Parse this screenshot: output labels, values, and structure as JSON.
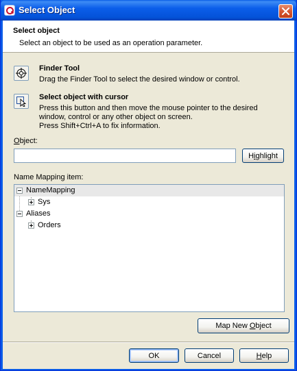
{
  "window": {
    "title": "Select Object"
  },
  "header": {
    "title": "Select object",
    "subtitle": "Select an object to be used as an operation parameter."
  },
  "finder_tool": {
    "title": "Finder Tool",
    "description": "Drag the Finder Tool to select the desired window or control.",
    "icon": "crosshair-target-icon"
  },
  "cursor_select": {
    "title": "Select object with cursor",
    "description_lines": [
      "Press this button and then move the mouse pointer to the desired",
      "window, control or any other object on screen.",
      "Press Shift+Ctrl+A to fix information."
    ],
    "icon": "cursor-select-icon"
  },
  "object_field": {
    "label_accel": "O",
    "label_rest": "bject:",
    "value": "",
    "placeholder": ""
  },
  "highlight_button": {
    "accel": "i",
    "before": "H",
    "after": "ghlight"
  },
  "mapping": {
    "label": "Name Mapping item:",
    "tree": [
      {
        "label": "NameMapping",
        "expanded": true,
        "level": 0,
        "selected": true
      },
      {
        "label": "Sys",
        "expanded": false,
        "level": 1
      },
      {
        "label": "Aliases",
        "expanded": true,
        "level": 0
      },
      {
        "label": "Orders",
        "expanded": false,
        "level": 1
      }
    ]
  },
  "map_new_button": {
    "before": "Map New ",
    "accel": "O",
    "after": "bject"
  },
  "footer": {
    "ok_label": "OK",
    "cancel_label": "Cancel",
    "help_accel": "H",
    "help_rest": "elp"
  },
  "colors": {
    "titlebar": "#0A5BE8",
    "close": "#D55734",
    "face": "#ECE9D8",
    "border": "#7F9DB9"
  }
}
